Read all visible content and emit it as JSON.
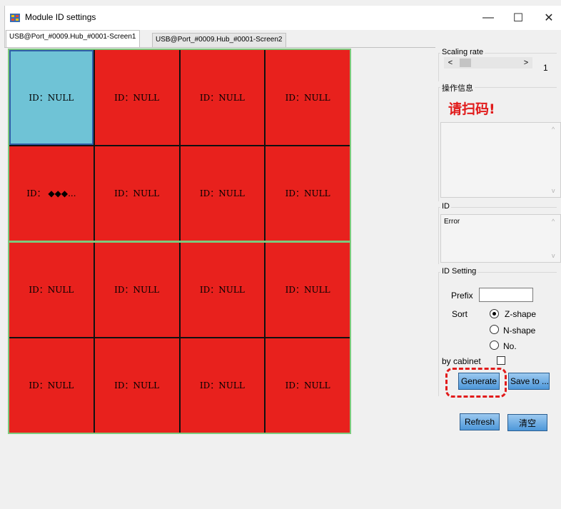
{
  "window": {
    "title": "Module ID settings",
    "minimize": "—",
    "maximize": "☐",
    "close": "✕"
  },
  "tabs": [
    {
      "label": "USB@Port_#0009.Hub_#0001-Screen1",
      "active": true
    },
    {
      "label": "USB@Port_#0009.Hub_#0001-Screen2",
      "active": false
    }
  ],
  "grid": {
    "rows": 4,
    "cols": 4,
    "cells": [
      "ID：NULL",
      "ID：NULL",
      "ID：NULL",
      "ID：NULL",
      "ID：   ◆◆◆...",
      "ID：NULL",
      "ID：NULL",
      "ID：NULL",
      "ID：NULL",
      "ID：NULL",
      "ID：NULL",
      "ID：NULL",
      "ID：NULL",
      "ID：NULL",
      "ID：NULL",
      "ID：NULL"
    ],
    "selected_index": 0,
    "colors": {
      "cell": "#e8211d",
      "selected": "#6fc3d6",
      "border": "#7dc97d"
    }
  },
  "panel": {
    "scaling": {
      "label": "Scaling rate",
      "left_arrow": "<",
      "right_arrow": ">",
      "value": "1"
    },
    "info": {
      "label": "操作信息",
      "message": "请扫码!"
    },
    "id_group": {
      "label": "ID",
      "text": "Error"
    },
    "id_setting": {
      "label": "ID Setting",
      "prefix_label": "Prefix",
      "prefix_value": "",
      "sort_label": "Sort",
      "sort_options": [
        "Z-shape",
        "N-shape",
        "No."
      ],
      "sort_selected": "Z-shape",
      "by_cabinet_label": "by cabinet",
      "by_cabinet_checked": false,
      "generate_label": "Generate",
      "save_label": "Save to ..."
    },
    "refresh_label": "Refresh",
    "clear_label": "清空"
  }
}
